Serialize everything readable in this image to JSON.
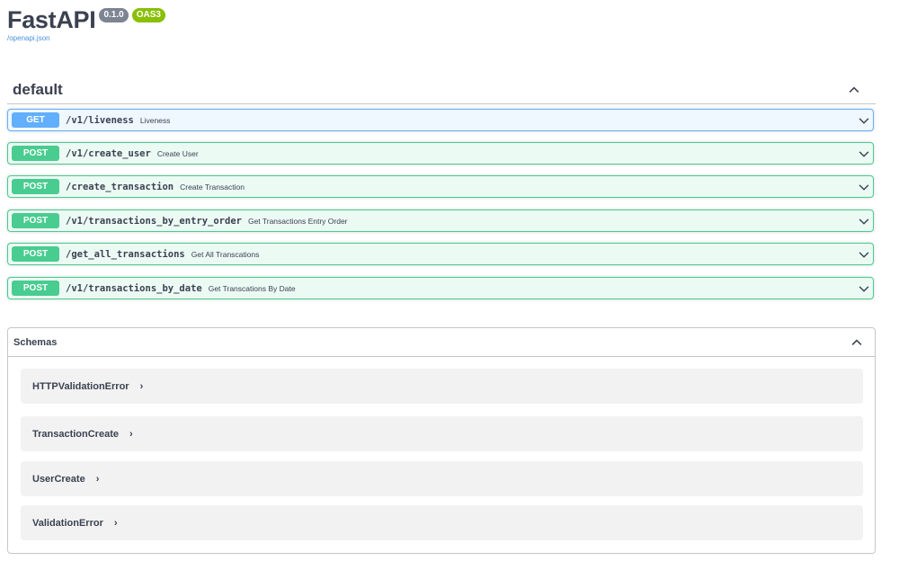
{
  "info": {
    "title": "FastAPI",
    "version": "0.1.0",
    "oas": "OAS3",
    "spec_link": "/openapi.json"
  },
  "tag": {
    "name": "default",
    "chevron_icon": "chevron-up-icon"
  },
  "operations": [
    {
      "method": "GET",
      "path": "/v1/liveness",
      "summary": "Liveness"
    },
    {
      "method": "POST",
      "path": "/v1/create_user",
      "summary": "Create User"
    },
    {
      "method": "POST",
      "path": "/create_transaction",
      "summary": "Create Transaction"
    },
    {
      "method": "POST",
      "path": "/v1/transactions_by_entry_order",
      "summary": "Get Transactions Entry Order"
    },
    {
      "method": "POST",
      "path": "/get_all_transactions",
      "summary": "Get All Transcations"
    },
    {
      "method": "POST",
      "path": "/v1/transactions_by_date",
      "summary": "Get Transcations By Date"
    }
  ],
  "schemas": {
    "title": "Schemas",
    "items": [
      {
        "name": "HTTPValidationError",
        "arrow": "›"
      },
      {
        "name": "TransactionCreate",
        "arrow": "›"
      },
      {
        "name": "UserCreate",
        "arrow": "›"
      },
      {
        "name": "ValidationError",
        "arrow": "›"
      }
    ]
  },
  "colors": {
    "get": "#61affe",
    "post": "#49cc90",
    "version_badge": "#7d8492",
    "oas_badge": "#89bf04",
    "link": "#4990e2",
    "text": "#3b4151"
  }
}
